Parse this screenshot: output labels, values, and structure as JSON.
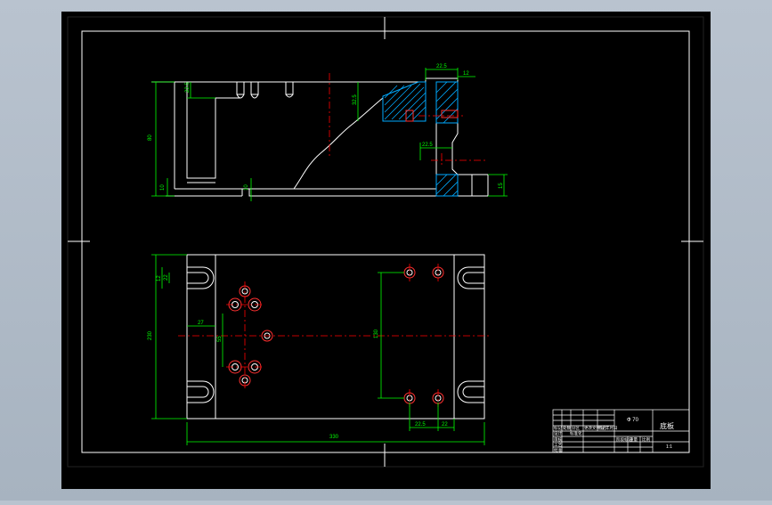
{
  "drawing": {
    "background": "#000000",
    "colors": {
      "border": "#ffffff",
      "outline": "#ffffff",
      "dimension": "#00ff00",
      "centerline": "#ff0000",
      "hatch": "#00aaff",
      "hole": "#ff3030"
    }
  },
  "front_view": {
    "dims": {
      "height": "80",
      "left_small": "10",
      "bottom_small": "10",
      "top_left": "22.5",
      "center_v": "32.5",
      "right_top_a": "22.5",
      "right_top_b": "12",
      "right_mid": "22.5",
      "right_side": "15"
    }
  },
  "top_view": {
    "dims": {
      "overall_width": "230",
      "overall_length": "330",
      "slot_a": "12",
      "slot_b": "22",
      "offset_x": "27",
      "hole_v": "55",
      "bolt_v": "130",
      "bottom_a": "22.5",
      "bottom_b": "22"
    }
  },
  "title_block": {
    "drawing_title": "Ф 70",
    "part_name": "底板",
    "scale": "1:1",
    "cells": [
      "标记",
      "处数",
      "分区",
      "更改文件号",
      "签名",
      "年月日",
      "设计",
      "标准化",
      "阶段标记",
      "重量",
      "比例",
      "审核",
      "工艺",
      "批准"
    ]
  }
}
